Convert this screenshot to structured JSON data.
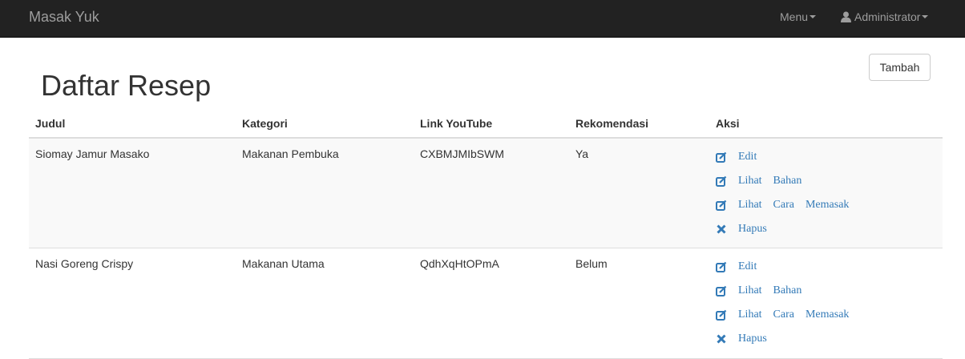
{
  "navbar": {
    "brand": "Masak Yuk",
    "menu_label": "Menu",
    "user_label": "Administrator"
  },
  "toolbar": {
    "add_label": "Tambah"
  },
  "page": {
    "title": "Daftar Resep"
  },
  "table": {
    "headers": [
      "Judul",
      "Kategori",
      "Link YouTube",
      "Rekomendasi",
      "Aksi"
    ],
    "rows": [
      {
        "judul": "Siomay Jamur Masako",
        "kategori": "Makanan Pembuka",
        "youtube": "CXBMJMIbSWM",
        "rekomendasi": "Ya"
      },
      {
        "judul": "Nasi Goreng Crispy",
        "kategori": "Makanan Utama",
        "youtube": "QdhXqHtOPmA",
        "rekomendasi": "Belum"
      }
    ],
    "actions": {
      "edit": [
        "Edit"
      ],
      "lihat_bahan": [
        "Lihat",
        "Bahan"
      ],
      "lihat_cara": [
        "Lihat",
        "Cara",
        "Memasak"
      ],
      "hapus": [
        "Hapus"
      ]
    }
  },
  "colors": {
    "navbar_bg": "#222222",
    "link": "#337ab7",
    "stripe": "#f9f9f9"
  }
}
